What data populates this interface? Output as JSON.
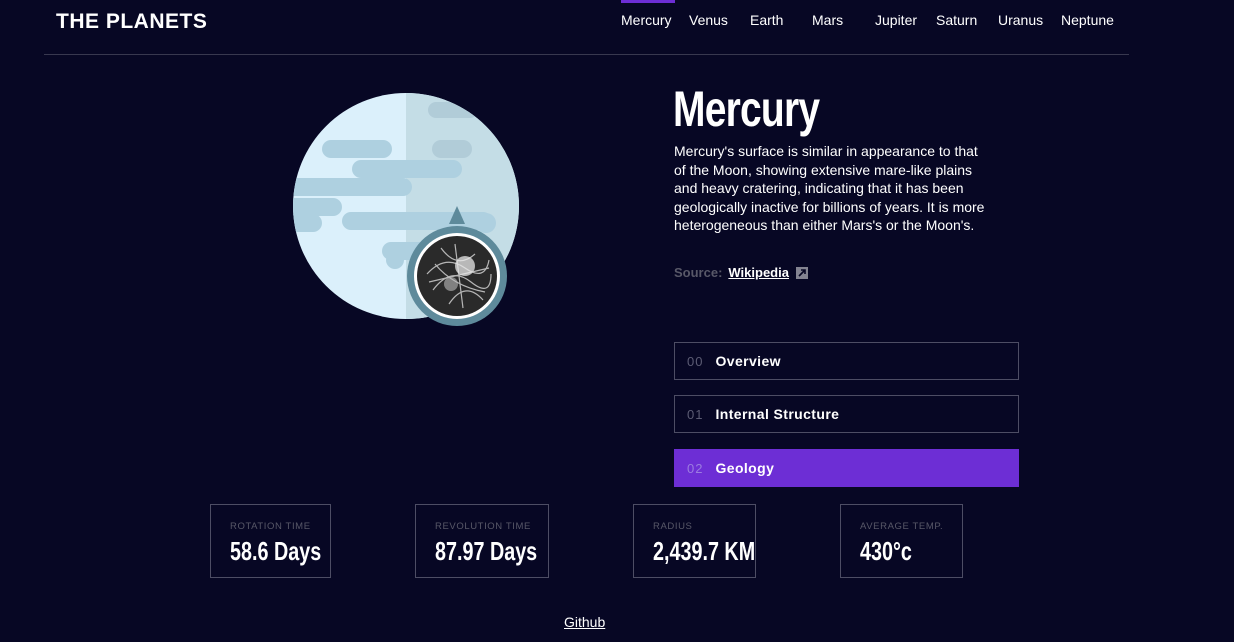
{
  "app": {
    "title": "THE PLANETS"
  },
  "nav": {
    "items": [
      {
        "label": "Mercury",
        "active": true
      },
      {
        "label": "Venus"
      },
      {
        "label": "Earth"
      },
      {
        "label": "Mars"
      },
      {
        "label": "Jupiter"
      },
      {
        "label": "Saturn"
      },
      {
        "label": "Uranus"
      },
      {
        "label": "Neptune"
      }
    ]
  },
  "planet": {
    "name": "Mercury",
    "description": "Mercury's surface is similar in appearance to that of the Moon, showing extensive mare-like plains and heavy cratering, indicating that it has been geologically inactive for billions of years. It is more heterogeneous than either Mars's or the Moon's.",
    "source_label": "Source:",
    "source_link": "Wikipedia"
  },
  "tabs": [
    {
      "num": "00",
      "label": "Overview"
    },
    {
      "num": "01",
      "label": "Internal Structure"
    },
    {
      "num": "02",
      "label": "Geology",
      "active": true
    }
  ],
  "stats": [
    {
      "label": "ROTATION TIME",
      "value": "58.6 Days"
    },
    {
      "label": "REVOLUTION TIME",
      "value": "87.97 Days"
    },
    {
      "label": "RADIUS",
      "value": "2,439.7 KM"
    },
    {
      "label": "AVERAGE TEMP.",
      "value": "430°c"
    }
  ],
  "footer": {
    "link": "Github"
  },
  "colors": {
    "background": "#070724",
    "accent": "#6d2ed5",
    "border": "#38384f"
  }
}
